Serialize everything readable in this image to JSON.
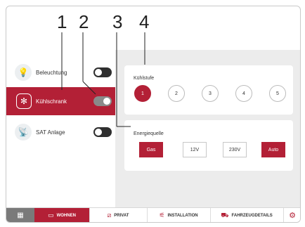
{
  "callouts": [
    "1",
    "2",
    "3",
    "4"
  ],
  "sidebar": {
    "items": [
      {
        "label": "Beleuchtung",
        "icon": "lightbulb-icon",
        "glyph": "💡",
        "toggle": "off"
      },
      {
        "label": "Kühlschrank",
        "icon": "snowflake-icon",
        "glyph": "✻",
        "toggle": "on"
      },
      {
        "label": "SAT Anlage",
        "icon": "satellite-icon",
        "glyph": "📡",
        "toggle": "off"
      }
    ]
  },
  "kuehlstufe": {
    "title": "Kühlstufe",
    "levels": [
      "1",
      "2",
      "3",
      "4",
      "5"
    ],
    "selected": "1"
  },
  "energiequelle": {
    "title": "Energiequelle",
    "options": [
      "Gas",
      "12V",
      "230V",
      "Auto"
    ],
    "selected": [
      "Gas",
      "Auto"
    ]
  },
  "nav": {
    "grid_glyph": "▦",
    "items": [
      {
        "label": "WOHNEN",
        "icon": "caravan-icon",
        "glyph": "▭",
        "active": true
      },
      {
        "label": "PRIVAT",
        "icon": "privacy-icon",
        "glyph": "⧄",
        "active": false
      },
      {
        "label": "INSTALLATION",
        "icon": "installation-icon",
        "glyph": "⚟",
        "active": false
      },
      {
        "label": "FAHRZEUGDETAILS",
        "icon": "vehicle-icon",
        "glyph": "⛟",
        "active": false
      }
    ],
    "settings_glyph": "⚙"
  },
  "colors": {
    "accent": "#b32036",
    "panel_bg": "#ececec",
    "toggle_off": "#2f2f2f",
    "toggle_on": "#8a8a8a"
  }
}
